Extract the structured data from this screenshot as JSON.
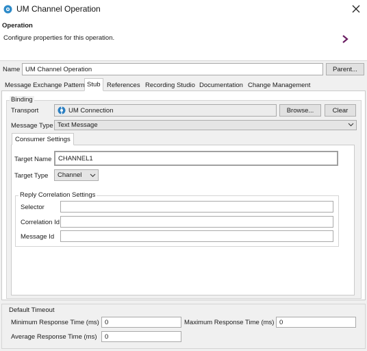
{
  "window": {
    "title": "UM Channel Operation",
    "icon": "service-gear-icon",
    "close_icon": "close-icon"
  },
  "header": {
    "title": "Operation",
    "description": "Configure properties for this operation.",
    "chevron_icon": "chevron-right-icon",
    "accent_color": "#6b1e63"
  },
  "name_row": {
    "label": "Name",
    "value": "UM Channel Operation",
    "parent_button": "Parent..."
  },
  "tabs": [
    {
      "label": "Message Exchange Pattern",
      "active": false
    },
    {
      "label": "Stub",
      "active": true
    },
    {
      "label": "References",
      "active": false
    },
    {
      "label": "Recording Studio",
      "active": false
    },
    {
      "label": "Documentation",
      "active": false
    },
    {
      "label": "Change Management",
      "active": false
    }
  ],
  "binding": {
    "group_label": "Binding",
    "transport_label": "Transport",
    "transport_value": "UM Connection",
    "transport_icon": "um-connection-icon",
    "browse_button": "Browse...",
    "clear_button": "Clear",
    "message_type_label": "Message Type",
    "message_type_value": "Text Message"
  },
  "consumer": {
    "tab_label": "Consumer Settings",
    "target_name_label": "Target Name",
    "target_name_value": "CHANNEL1",
    "target_type_label": "Target Type",
    "target_type_value": "Channel",
    "reply": {
      "group_label": "Reply Correlation Settings",
      "selector_label": "Selector",
      "selector_value": "",
      "correlation_label": "Correlation Id",
      "correlation_value": "",
      "message_id_label": "Message Id",
      "message_id_value": ""
    }
  },
  "timeout": {
    "group_label": "Default Timeout",
    "min_label": "Minimum Response Time (ms)",
    "min_value": "0",
    "max_label": "Maximum Response Time (ms)",
    "max_value": "0",
    "avg_label": "Average Response Time (ms)",
    "avg_value": "0"
  }
}
